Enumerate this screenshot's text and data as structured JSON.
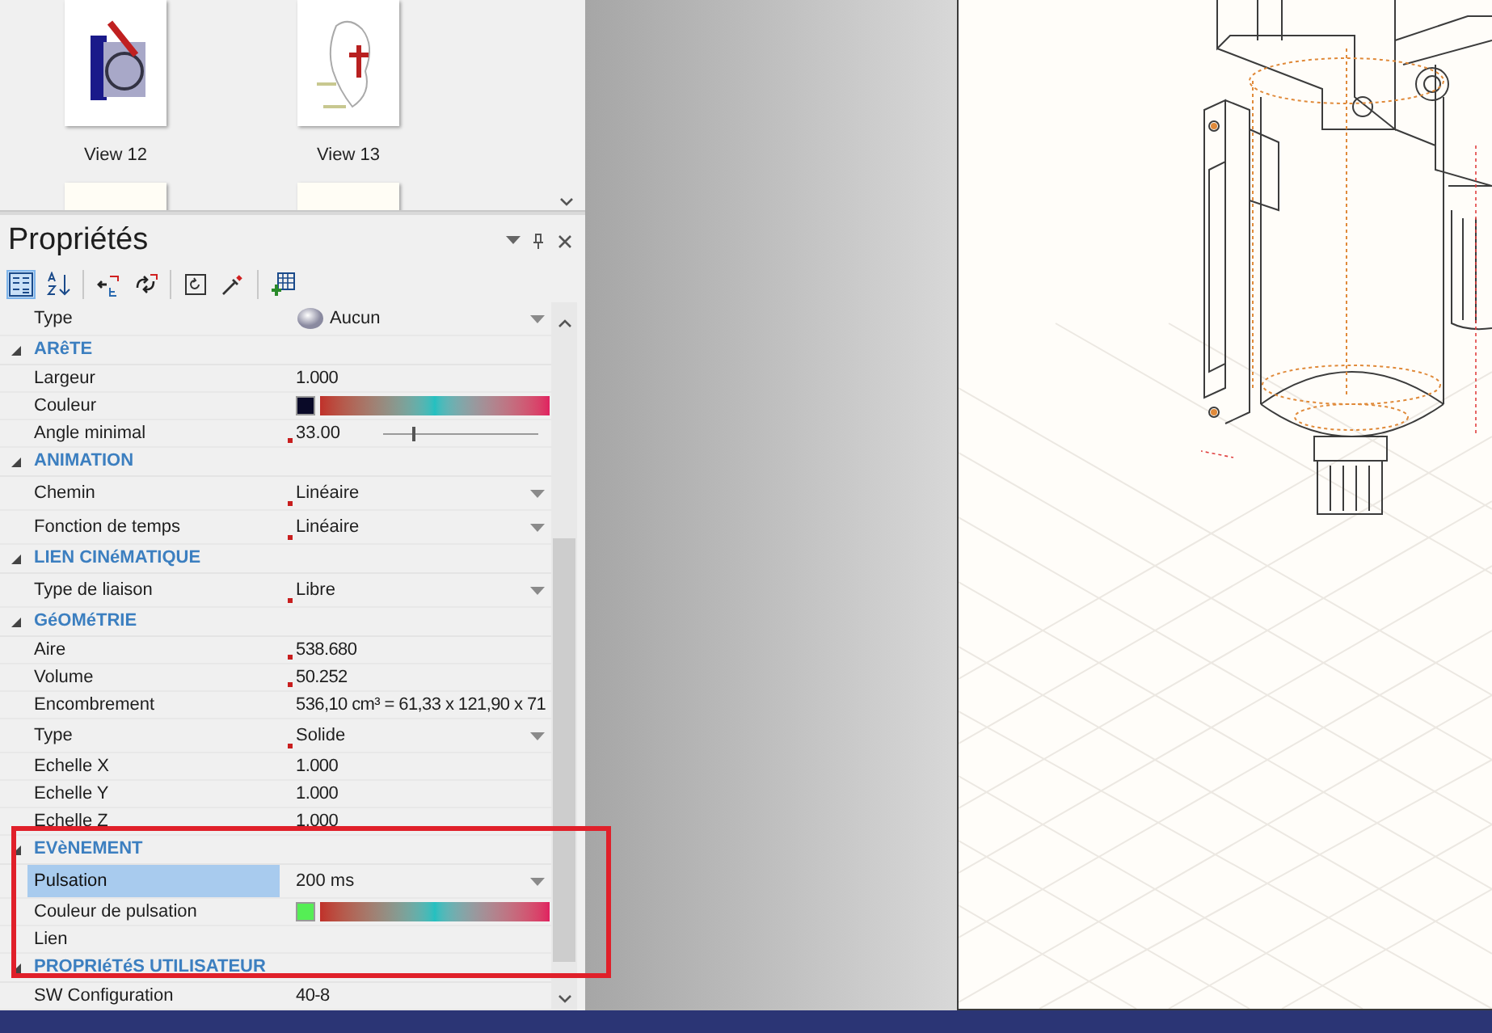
{
  "views": [
    {
      "label": "View 12"
    },
    {
      "label": "View 13"
    }
  ],
  "properties_panel": {
    "title": "Propriétés",
    "toolbar": [
      {
        "kind": "categorized",
        "selected": true
      },
      {
        "kind": "alphabetical",
        "selected": false
      },
      {
        "kind": "collapse",
        "selected": false
      },
      {
        "kind": "expand",
        "selected": false
      },
      {
        "kind": "reset",
        "selected": false
      },
      {
        "kind": "eyedropper",
        "selected": false
      },
      {
        "kind": "add-table",
        "selected": false
      }
    ],
    "grid": [
      {
        "kind": "material",
        "name": "Type",
        "value": "Aucun",
        "modified": false,
        "selected": false
      },
      {
        "kind": "category",
        "label": "ARêTE",
        "expanded": true
      },
      {
        "kind": "text",
        "name": "Largeur",
        "value": "1.000",
        "modified": false,
        "selected": false
      },
      {
        "kind": "color",
        "name": "Couleur",
        "color": "#0a0a28",
        "modified": false,
        "selected": false
      },
      {
        "kind": "slider",
        "name": "Angle minimal",
        "value": "33.00",
        "level": 0.19,
        "modified": true,
        "selected": false
      },
      {
        "kind": "category",
        "label": "ANIMATION",
        "expanded": true
      },
      {
        "kind": "dropdown",
        "name": "Chemin",
        "value": "Linéaire",
        "modified": true,
        "selected": false
      },
      {
        "kind": "dropdown",
        "name": "Fonction de temps",
        "value": "Linéaire",
        "modified": true,
        "selected": false
      },
      {
        "kind": "category",
        "label": "LIEN CINéMATIQUE",
        "expanded": true
      },
      {
        "kind": "dropdown",
        "name": "Type de liaison",
        "value": "Libre",
        "modified": true,
        "selected": false
      },
      {
        "kind": "category",
        "label": "GéOMéTRIE",
        "expanded": true
      },
      {
        "kind": "text",
        "name": "Aire",
        "value": "538.680",
        "modified": true,
        "selected": false
      },
      {
        "kind": "text",
        "name": "Volume",
        "value": "50.252",
        "modified": true,
        "selected": false
      },
      {
        "kind": "text",
        "name": "Encombrement",
        "value": "536,10 cm³ = 61,33 x 121,90 x 71",
        "modified": false,
        "selected": false
      },
      {
        "kind": "dropdown",
        "name": "Type",
        "value": "Solide",
        "modified": true,
        "selected": false
      },
      {
        "kind": "text",
        "name": "Echelle X",
        "value": "1.000",
        "modified": false,
        "selected": false
      },
      {
        "kind": "text",
        "name": "Echelle Y",
        "value": "1.000",
        "modified": false,
        "selected": false
      },
      {
        "kind": "text",
        "name": "Echelle Z",
        "value": "1.000",
        "modified": false,
        "selected": false
      },
      {
        "kind": "category",
        "label": "EVèNEMENT",
        "expanded": true
      },
      {
        "kind": "dropdown",
        "name": "Pulsation",
        "value": "200 ms",
        "modified": false,
        "selected": true
      },
      {
        "kind": "color",
        "name": "Couleur de pulsation",
        "color": "#55ee55",
        "modified": false,
        "selected": false
      },
      {
        "kind": "text",
        "name": "Lien",
        "modified": false,
        "selected": false
      },
      {
        "kind": "category",
        "label": "PROPRIéTéS UTILISATEUR",
        "expanded": true
      },
      {
        "kind": "text",
        "name": "SW Configuration",
        "value": "40-8",
        "modified": false,
        "selected": false
      }
    ]
  }
}
